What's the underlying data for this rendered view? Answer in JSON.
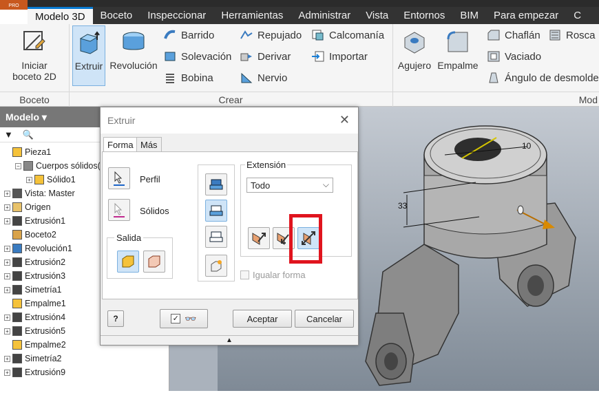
{
  "app": {
    "badge": "PRO"
  },
  "menu": [
    "Modelo 3D",
    "Boceto",
    "Inspeccionar",
    "Herramientas",
    "Administrar",
    "Vista",
    "Entornos",
    "BIM",
    "Para empezar",
    "C"
  ],
  "ribbon": {
    "boceto_btn_line1": "Iniciar",
    "boceto_btn_line2": "boceto 2D",
    "boceto_group": "Boceto",
    "crear_group": "Crear",
    "mod_group": "Mod",
    "extruir": "Extruir",
    "revolucion": "Revolución",
    "barrido": "Barrido",
    "solevacion": "Solevación",
    "bobina": "Bobina",
    "repujado": "Repujado",
    "derivar": "Derivar",
    "nervio": "Nervio",
    "calcomania": "Calcomanía",
    "importar": "Importar",
    "agujero": "Agujero",
    "empalme": "Empalme",
    "chaflan": "Chaflán",
    "rosca": "Rosca",
    "vaciado": "Vaciado",
    "angulo": "Ángulo de desmolde"
  },
  "browser": {
    "header": "Modelo ▾",
    "tree": [
      "Pieza1",
      "Cuerpos sólidos(1",
      "Sólido1",
      "Vista: Master",
      "Origen",
      "Extrusión1",
      "Boceto2",
      "Revolución1",
      "Extrusión2",
      "Extrusión3",
      "Simetría1",
      "Empalme1",
      "Extrusión4",
      "Extrusión5",
      "Empalme2",
      "Simetría2",
      "Extrusión9"
    ]
  },
  "dialog": {
    "title": "Extruir",
    "tab_forma": "Forma",
    "tab_mas": "Más",
    "perfil": "Perfil",
    "solidos": "Sólidos",
    "salida": "Salida",
    "extension": "Extensión",
    "extension_value": "Todo",
    "igualar": "Igualar forma",
    "aceptar": "Aceptar",
    "cancelar": "Cancelar"
  },
  "viewport": {
    "dim1": "10",
    "dim2": "33"
  },
  "colors": {
    "accent": "#0a7ad1",
    "annotation": "#e0141e"
  }
}
